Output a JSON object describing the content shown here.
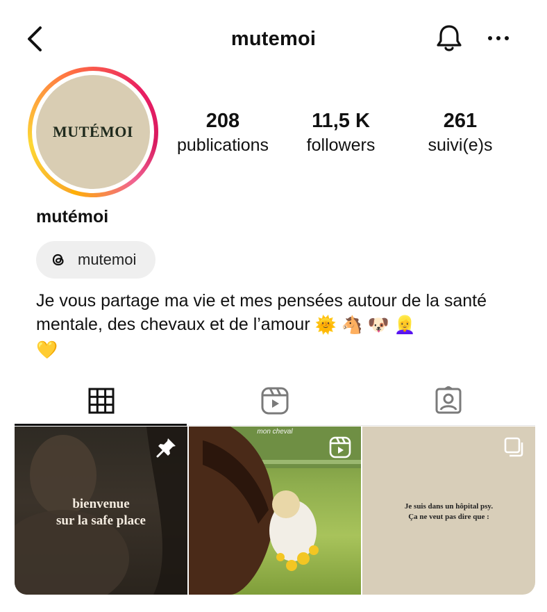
{
  "header": {
    "username": "mutemoi",
    "back_icon": "chevron-left-icon",
    "notifications_icon": "bell-icon",
    "more_icon": "more-horizontal-icon"
  },
  "profile": {
    "avatar_text": "MUTÉMOI",
    "full_name": "mutémoi",
    "stats": [
      {
        "value": "208",
        "label": "publications"
      },
      {
        "value": "11,5 K",
        "label": "followers"
      },
      {
        "value": "261",
        "label": "suivi(e)s"
      }
    ],
    "threads_chip": {
      "icon": "threads-icon",
      "label": "mutemoi"
    },
    "bio": {
      "text": "Je vous partage ma vie et mes pensées autour de la santé mentale, des chevaux et de l’amour",
      "emojis": [
        "🌞",
        "🐴",
        "🐶",
        "👱‍♀️",
        "💛"
      ]
    }
  },
  "tabs": [
    {
      "name": "posts",
      "icon": "grid-icon",
      "active": true
    },
    {
      "name": "reels",
      "icon": "reels-icon",
      "active": false
    },
    {
      "name": "tagged",
      "icon": "tagged-icon",
      "active": false
    }
  ],
  "posts": [
    {
      "caption": "bienvenue\nsur la safe place",
      "badge": "pin-icon"
    },
    {
      "caption": "mon cheval",
      "badge": "reels-icon"
    },
    {
      "caption": "Je suis dans un hôpital psy.\nÇa ne veut pas dire que :",
      "badge": "carousel-icon"
    }
  ],
  "colors": {
    "avatar_bg": "#d9cdb3",
    "chip_bg": "#efefef",
    "post3_bg": "#d8ceb9"
  }
}
